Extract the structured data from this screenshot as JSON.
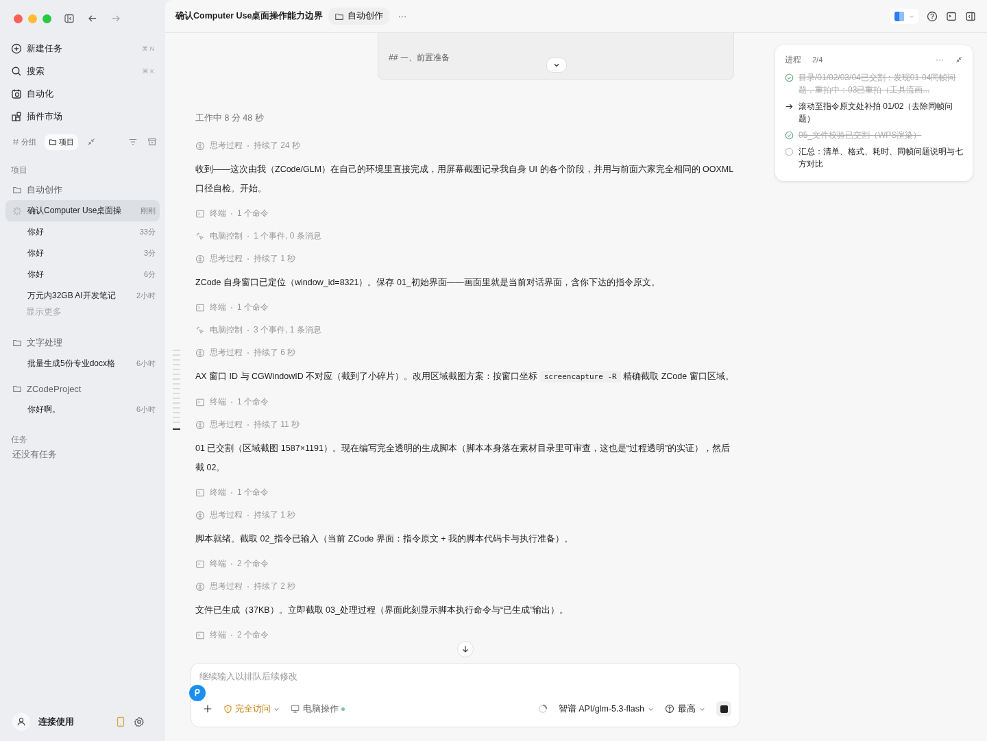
{
  "sidebar": {
    "nav": [
      {
        "label": "新建任务",
        "shortcut": "⌘ N"
      },
      {
        "label": "搜索",
        "shortcut": "⌘ K"
      },
      {
        "label": "自动化"
      },
      {
        "label": "插件市场"
      }
    ],
    "view_toggle": [
      {
        "label": "分组",
        "selected": false
      },
      {
        "label": "项目",
        "selected": true
      }
    ],
    "projects_heading": "项目",
    "projects": [
      {
        "name": "自动创作",
        "tasks": [
          {
            "title": "确认Computer Use桌面操",
            "time": "刚刚",
            "selected": true,
            "running": true
          },
          {
            "title": "你好",
            "time": "33分",
            "selected": false,
            "running": false
          },
          {
            "title": "你好",
            "time": "3分",
            "selected": false,
            "running": false
          },
          {
            "title": "你好",
            "time": "6分",
            "selected": false,
            "running": false
          },
          {
            "title": "万元内32GB AI开发笔记",
            "time": "2小时",
            "selected": false,
            "running": false
          }
        ],
        "more": "显示更多"
      },
      {
        "name": "文字处理",
        "tasks": [
          {
            "title": "批量生成5份专业docx格",
            "time": "6小时",
            "selected": false,
            "running": false
          }
        ]
      },
      {
        "name": "ZCodeProject",
        "tasks": [
          {
            "title": "你好啊。",
            "time": "6小时",
            "selected": false,
            "running": false
          }
        ]
      }
    ],
    "tasks_heading": "任务",
    "tasks_empty": "还没有任务",
    "footer": {
      "label": "连接使用"
    }
  },
  "header": {
    "title": "确认Computer Use桌面操作能力边界",
    "project": "自动创作",
    "more": "···"
  },
  "quoted_card": {
    "line": "## 一、前置准备"
  },
  "status": "工作中 8 分 48 秒",
  "messages": [
    {
      "kind": "thinking",
      "label": "思考过程",
      "detail": "持续了 24 秒"
    },
    {
      "kind": "text",
      "parts": [
        {
          "kind": "text",
          "text": "收到——这次由我（ZCode/GLM）在自己的环境里直接完成，用屏幕截图记录我自身 UI 的各个阶段，并用与前面六家完全相同的 OOXML 口径自检。开始。"
        }
      ]
    },
    {
      "kind": "terminal",
      "label": "终端",
      "detail": "1 个命令"
    },
    {
      "kind": "computer",
      "label": "电脑控制",
      "detail": "1 个事件, 0 条消息"
    },
    {
      "kind": "thinking",
      "label": "思考过程",
      "detail": "持续了 1 秒"
    },
    {
      "kind": "text",
      "parts": [
        {
          "kind": "text",
          "text": "ZCode 自身窗口已定位（window_id=8321）。保存 01_初始界面——画面里就是当前对话界面，含你下达的指令原文。"
        }
      ]
    },
    {
      "kind": "terminal",
      "label": "终端",
      "detail": "1 个命令"
    },
    {
      "kind": "computer",
      "label": "电脑控制",
      "detail": "3 个事件, 1 条消息"
    },
    {
      "kind": "thinking",
      "label": "思考过程",
      "detail": "持续了 6 秒"
    },
    {
      "kind": "text",
      "parts": [
        {
          "kind": "text",
          "text": "AX 窗口 ID 与 CGWindowID 不对应（截到了小碎片）。改用区域截图方案：按窗口坐标 "
        },
        {
          "kind": "code",
          "text": "screencapture -R"
        },
        {
          "kind": "text",
          "text": " 精确截取 ZCode 窗口区域。"
        }
      ]
    },
    {
      "kind": "terminal",
      "label": "终端",
      "detail": "1 个命令"
    },
    {
      "kind": "thinking",
      "label": "思考过程",
      "detail": "持续了 11 秒"
    },
    {
      "kind": "text",
      "parts": [
        {
          "kind": "text",
          "text": "01 已交割（区域截图 1587×1191）。现在编写完全透明的生成脚本（脚本本身落在素材目录里可审查，这也是“过程透明”的实证），然后截 02。"
        }
      ]
    },
    {
      "kind": "terminal",
      "label": "终端",
      "detail": "1 个命令"
    },
    {
      "kind": "thinking",
      "label": "思考过程",
      "detail": "持续了 1 秒"
    },
    {
      "kind": "text",
      "parts": [
        {
          "kind": "text",
          "text": "脚本就绪。截取 02_指令已输入（当前 ZCode 界面：指令原文 + 我的脚本代码卡与执行准备）。"
        }
      ]
    },
    {
      "kind": "terminal",
      "label": "终端",
      "detail": "2 个命令"
    },
    {
      "kind": "thinking",
      "label": "思考过程",
      "detail": "持续了 2 秒"
    },
    {
      "kind": "text",
      "parts": [
        {
          "kind": "text",
          "text": "文件已生成（37KB）。立即截取 03_处理过程（界面此刻显示脚本执行命令与“已生成”输出）。"
        }
      ]
    },
    {
      "kind": "terminal",
      "label": "终端",
      "detail": "2 个命令"
    }
  ],
  "progress": {
    "title": "进程",
    "count": "2/4",
    "more": "···",
    "items": [
      {
        "kind": "done",
        "text": "目录/01/02/03/04已交割；发现01-04同帧问题，重拍中：03已重拍（工具流画..."
      },
      {
        "kind": "current",
        "text": "滚动至指令原文处补拍 01/02（去除同帧问题）"
      },
      {
        "kind": "done",
        "text": "05_文件校验已交割（WPS渲染）"
      },
      {
        "kind": "pending",
        "text": "汇总：清单、格式、耗时、同帧问题说明与七方对比"
      }
    ]
  },
  "composer": {
    "placeholder": "继续输入以排队后续修改",
    "access": "完全访问",
    "computer": "电脑操作",
    "computer_on": true,
    "model": "智谱 API/glm-5.3-flash",
    "effort": "最高"
  }
}
